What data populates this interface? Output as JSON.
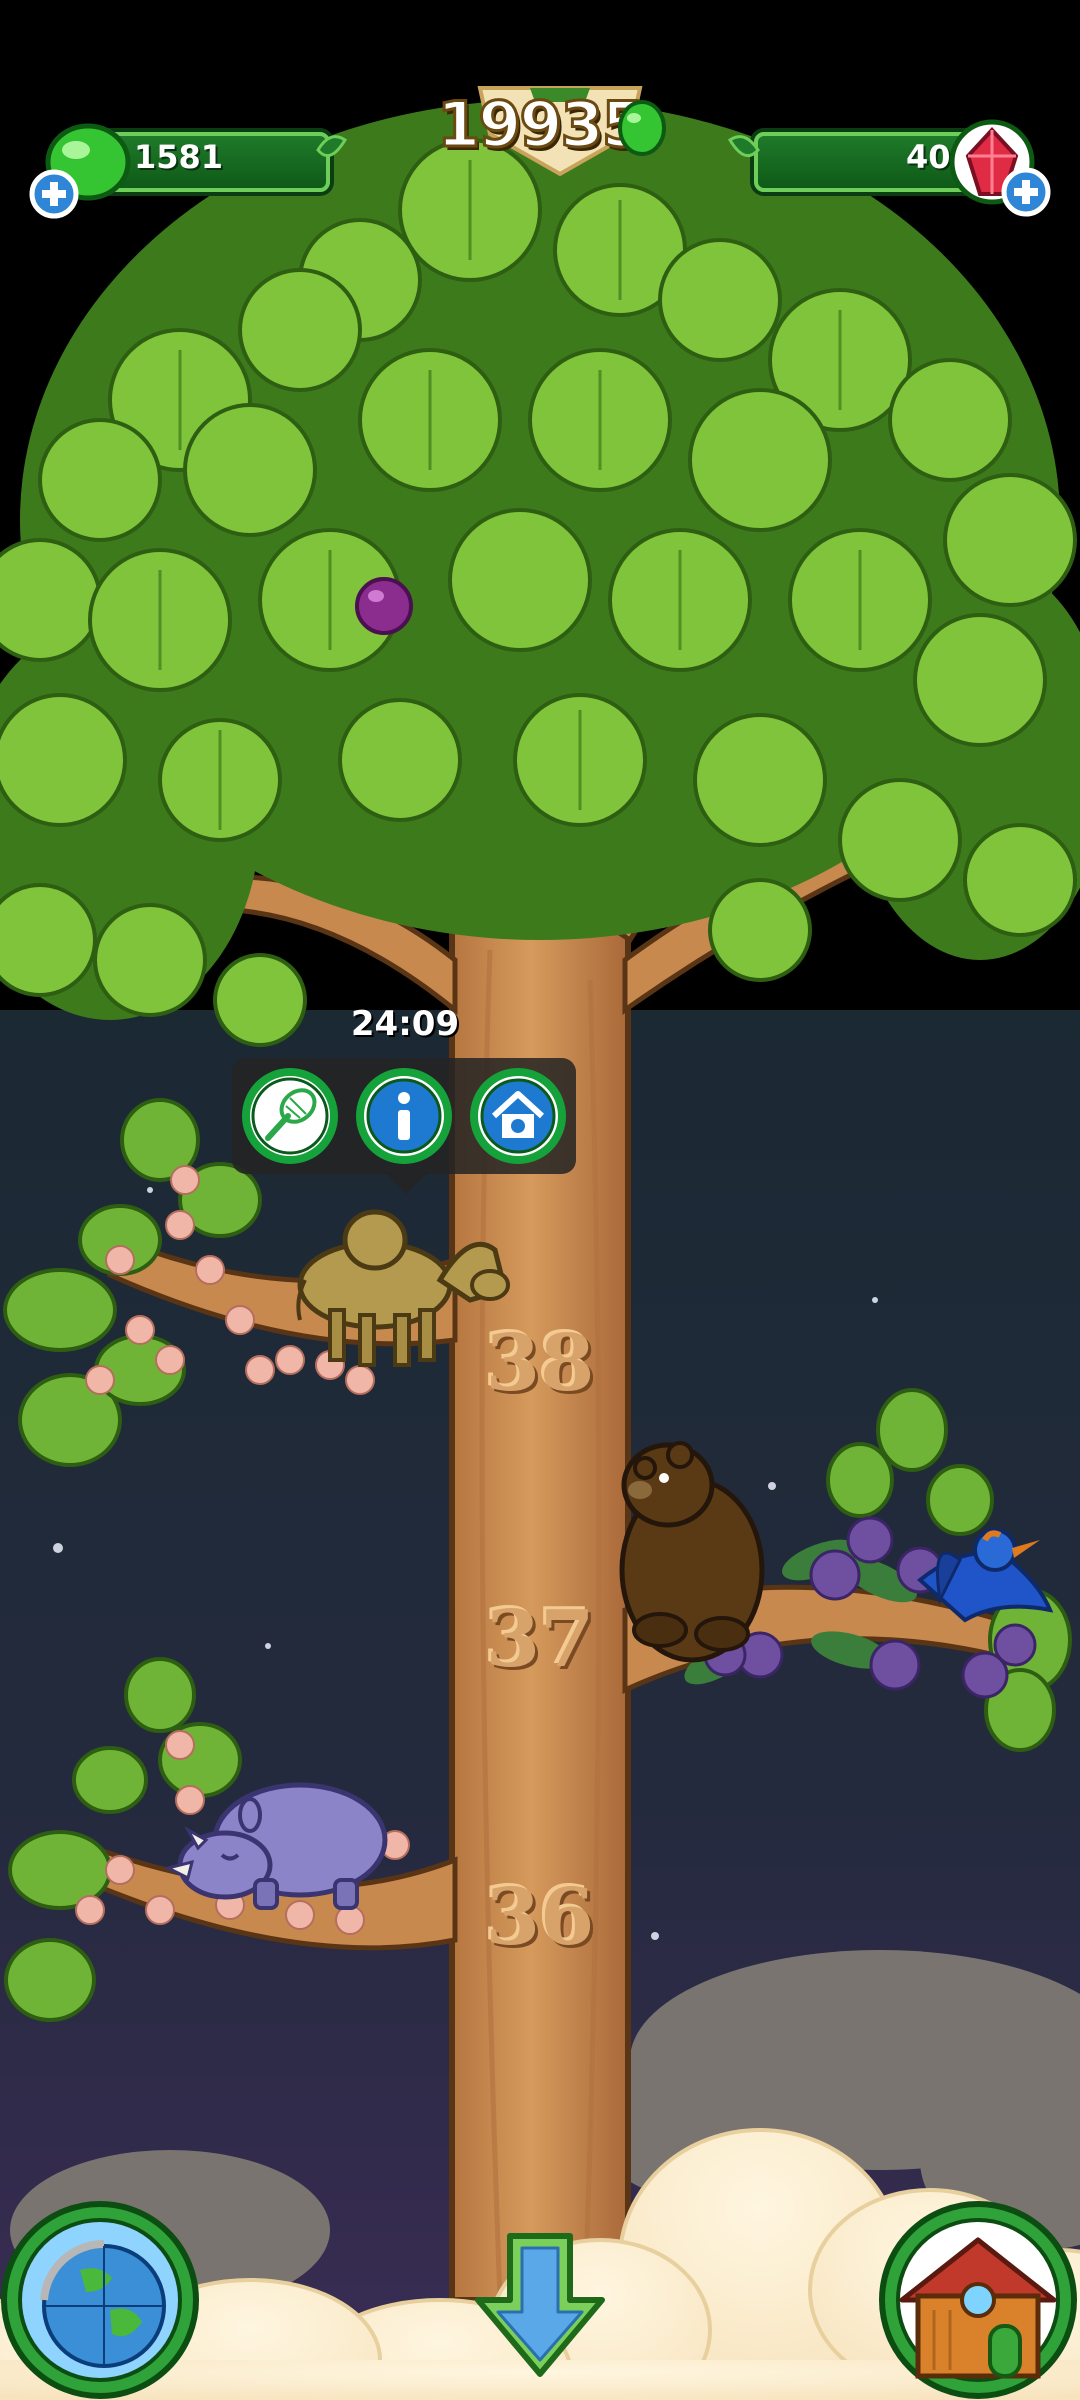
{
  "hud": {
    "coins": "1581",
    "gems": "40",
    "score": "19935"
  },
  "popup": {
    "timer": "24:09",
    "buttons": [
      "catch-net",
      "info",
      "house-home"
    ]
  },
  "levels": [
    "38",
    "37",
    "36"
  ],
  "animals": [
    "camel",
    "bear",
    "blue-bird",
    "rhino"
  ],
  "bottom_buttons": [
    "globe",
    "scroll-down",
    "house"
  ],
  "colors": {
    "leaf": "#7fc43a",
    "leaf_dark": "#3d7a1c",
    "trunk": "#c8894e",
    "sky_top": "#1b2933",
    "sky_bottom": "#3b2c55",
    "hud_green": "#1f7a2a"
  }
}
